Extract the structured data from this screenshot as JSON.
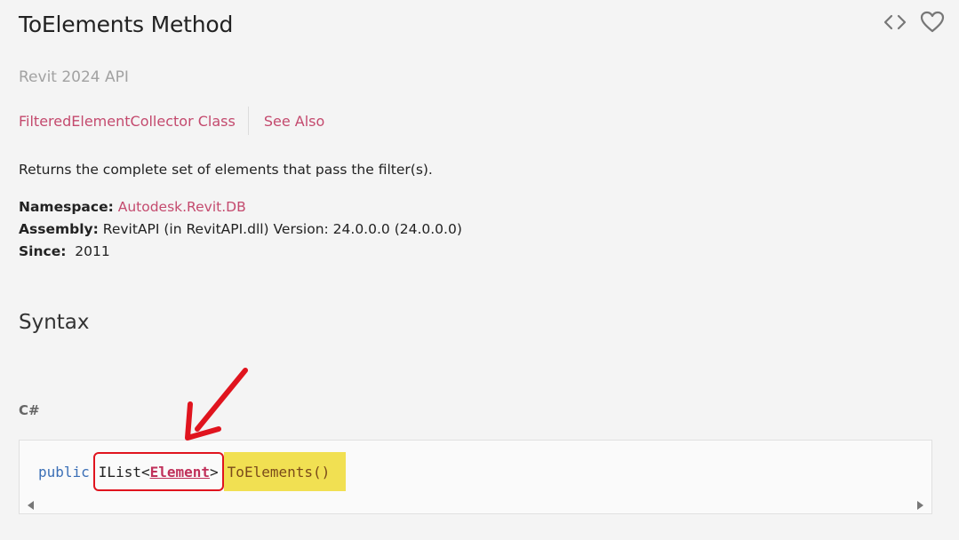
{
  "page": {
    "title": "ToElements Method",
    "subtitle": "Revit 2024 API",
    "icons": {
      "code": "code-icon",
      "favorite": "heart-icon"
    }
  },
  "breadcrumbs": {
    "class_link": "FilteredElementCollector Class",
    "see_also": "See Also"
  },
  "summary": "Returns the complete set of elements that pass the filter(s).",
  "meta": {
    "namespace_label": "Namespace:",
    "namespace_value": "Autodesk.Revit.DB",
    "assembly_label": "Assembly:",
    "assembly_value": "RevitAPI (in RevitAPI.dll) Version: 24.0.0.0 (24.0.0.0)",
    "since_label": "Since:",
    "since_value": "2011"
  },
  "syntax": {
    "heading": "Syntax",
    "language": "C#",
    "keyword": "public",
    "type_prefix": "IList<",
    "type_link": "Element",
    "type_suffix": ">",
    "method": "ToElements()"
  },
  "colors": {
    "link": "#c44a6e",
    "highlight": "#f1e052",
    "annotation_red": "#e0141e"
  }
}
